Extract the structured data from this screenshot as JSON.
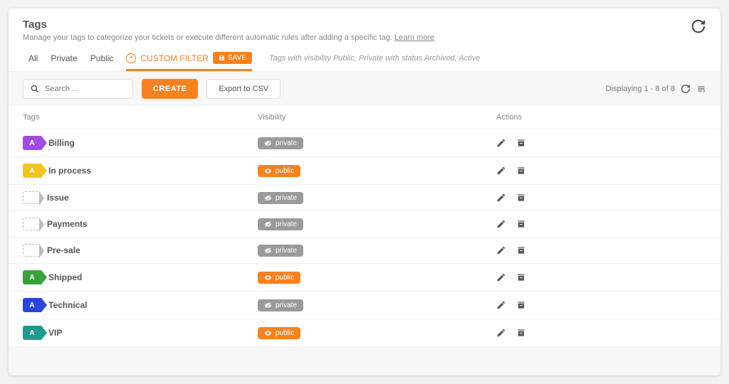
{
  "header": {
    "title": "Tags",
    "subtitle_pre": "Manage your tags to categorize your tickets or execute different automatic rules after adding a specific tag. ",
    "learn_more": "Learn more"
  },
  "tabs": {
    "all": "All",
    "private": "Private",
    "public": "Public",
    "custom": "CUSTOM FILTER",
    "save": "SAVE",
    "desc": "Tags with visibility Public, Private with status Archived, Active"
  },
  "toolbar": {
    "search_placeholder": "Search ...",
    "create": "CREATE",
    "export": "Export to CSV",
    "displaying": "Displaying 1 - 8 of 8"
  },
  "columns": {
    "tags": "Tags",
    "visibility": "Visibility",
    "actions": "Actions"
  },
  "badges": {
    "private": "private",
    "public": "public"
  },
  "rows": [
    {
      "letter": "A",
      "color": "purple",
      "name": "Billing",
      "vis": "private"
    },
    {
      "letter": "A",
      "color": "yellow",
      "name": "In process",
      "vis": "public"
    },
    {
      "letter": "",
      "color": "dashed",
      "name": "Issue",
      "vis": "private"
    },
    {
      "letter": "",
      "color": "dashed",
      "name": "Payments",
      "vis": "private"
    },
    {
      "letter": "",
      "color": "dashed",
      "name": "Pre-sale",
      "vis": "private"
    },
    {
      "letter": "A",
      "color": "green",
      "name": "Shipped",
      "vis": "public"
    },
    {
      "letter": "A",
      "color": "blue",
      "name": "Technical",
      "vis": "private"
    },
    {
      "letter": "A",
      "color": "teal",
      "name": "VIP",
      "vis": "public"
    }
  ]
}
